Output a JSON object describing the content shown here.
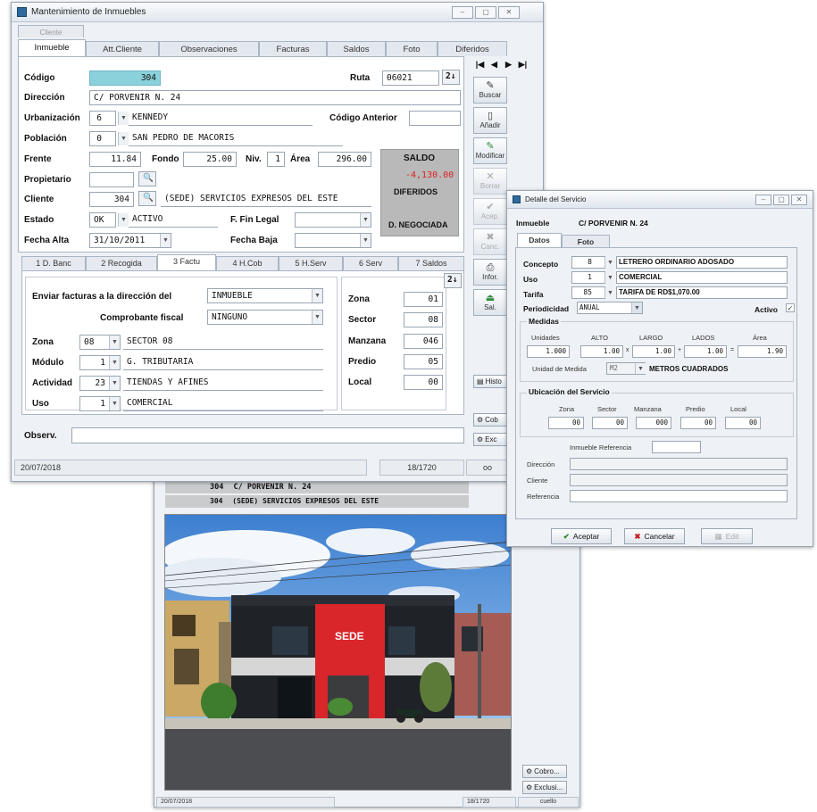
{
  "main": {
    "title": "Mantenimiento de Inmuebles",
    "tab_top": "Cliente",
    "tabs": [
      "Inmueble",
      "Att.Cliente",
      "Observaciones",
      "Facturas",
      "Saldos",
      "Foto",
      "Diferidos"
    ],
    "labels": {
      "codigo": "Código",
      "ruta": "Ruta",
      "direccion": "Dirección",
      "urbanizacion": "Urbanización",
      "codigo_anterior": "Código Anterior",
      "poblacion": "Población",
      "frente": "Frente",
      "fondo": "Fondo",
      "niv": "Niv.",
      "area": "Área",
      "propietario": "Propietario",
      "cliente": "Cliente",
      "estado": "Estado",
      "fecha_fin_legal": "F. Fin Legal",
      "fecha_alta": "Fecha Alta",
      "fecha_baja": "Fecha Baja"
    },
    "values": {
      "codigo": "304",
      "ruta": "06021",
      "ruta_btn": "2↓",
      "direccion": "C/ PORVENIR N. 24",
      "urb_code": "6",
      "urb_name": "KENNEDY",
      "pob_code": "0",
      "pob_name": "SAN PEDRO DE MACORIS",
      "frente": "11.84",
      "fondo": "25.00",
      "niv": "1",
      "area": "296.00",
      "cliente_code": "304",
      "cliente_name": "(SEDE) SERVICIOS EXPRESOS DEL ESTE",
      "estado_code": "OK",
      "estado_name": "ACTIVO",
      "fecha_alta": "31/10/2011"
    },
    "saldo": {
      "title": "SALDO",
      "value": "-4,130.00",
      "diferidos": "DIFERIDOS",
      "negociada": "D. NEGOCIADA"
    },
    "side_buttons": [
      "Buscar",
      "Añadir",
      "Modificar",
      "Borrar",
      "Acep.",
      "Canc.",
      "Infor.",
      "Sal."
    ],
    "sub_tabs": [
      "1 D. Banc",
      "2 Recogida",
      "3 Factu",
      "4 H.Cob",
      "5 H.Serv",
      "6 Serv",
      "7 Saldos"
    ],
    "factu": {
      "enviar_label": "Enviar facturas a la dirección del",
      "enviar_value": "INMUEBLE",
      "comprobante_label": "Comprobante fiscal",
      "comprobante_value": "NINGUNO",
      "zona_label": "Zona",
      "zona_code": "08",
      "zona_name": "SECTOR 08",
      "modulo_label": "Módulo",
      "modulo_code": "1",
      "modulo_name": "G. TRIBUTARIA",
      "actividad_label": "Actividad",
      "actividad_code": "23",
      "actividad_name": "TIENDAS Y AFINES",
      "uso_label": "Uso",
      "uso_code": "1",
      "uso_name": "COMERCIAL"
    },
    "location": {
      "zona_label": "Zona",
      "zona": "01",
      "sector_label": "Sector",
      "sector": "08",
      "manzana_label": "Manzana",
      "manzana": "046",
      "predio_label": "Predio",
      "predio": "05",
      "local_label": "Local",
      "local": "00",
      "sort_btn": "2↓"
    },
    "observ_label": "Observ.",
    "side_small": [
      "Histo",
      "Cob",
      "Exc"
    ],
    "status_date": "20/07/2018",
    "status_count": "18/1720",
    "status_user": "oo"
  },
  "photo_window": {
    "line1_code": "304",
    "line1_text": "C/ PORVENIR N. 24",
    "line2_code": "304",
    "line2_text": "(SEDE) SERVICIOS EXPRESOS DEL ESTE",
    "sign_text": "SEDE",
    "buttons": [
      "Cobro...",
      "Exclusi..."
    ],
    "status_date": "20/07/2018",
    "status_count": "18/1720",
    "status_user": "cuello"
  },
  "detail": {
    "title": "Detalle del Servicio",
    "inmueble_label": "Inmueble",
    "inmueble_value": "C/ PORVENIR N. 24",
    "tabs": [
      "Datos",
      "Foto"
    ],
    "concepto_label": "Concepto",
    "concepto_code": "8",
    "concepto_name": "LETRERO ORDINARIO ADOSADO",
    "uso_label": "Uso",
    "uso_code": "1",
    "uso_name": "COMERCIAL",
    "tarifa_label": "Tarifa",
    "tarifa_code": "85",
    "tarifa_name": "TARIFA DE RD$1,070.00",
    "periodicidad_label": "Periodicidad",
    "periodicidad_value": "ANUAL",
    "activo_label": "Activo",
    "medidas_title": "Medidas",
    "medidas_headers": [
      "Unidades",
      "ALTO",
      "LARGO",
      "LADOS",
      "Área"
    ],
    "medidas_values": [
      "1.000",
      "1.00",
      "1.00",
      "1.00",
      "1.90"
    ],
    "unidad_label": "Unidad de Medida",
    "unidad_code": "M2",
    "unidad_name": "METROS CUADRADOS",
    "ubic_title": "Ubicación del Servicio",
    "ubic_headers": [
      "Zona",
      "Sector",
      "Manzana",
      "Predio",
      "Local"
    ],
    "ubic_values": [
      "00",
      "00",
      "000",
      "00",
      "00"
    ],
    "inmueble_ref_label": "Inmueble Referencia",
    "direccion_label": "Dirección",
    "cliente_label": "Cliente",
    "referencia_label": "Referencia",
    "buttons": [
      "Aceptar",
      "Cancelar",
      "Edit"
    ]
  }
}
